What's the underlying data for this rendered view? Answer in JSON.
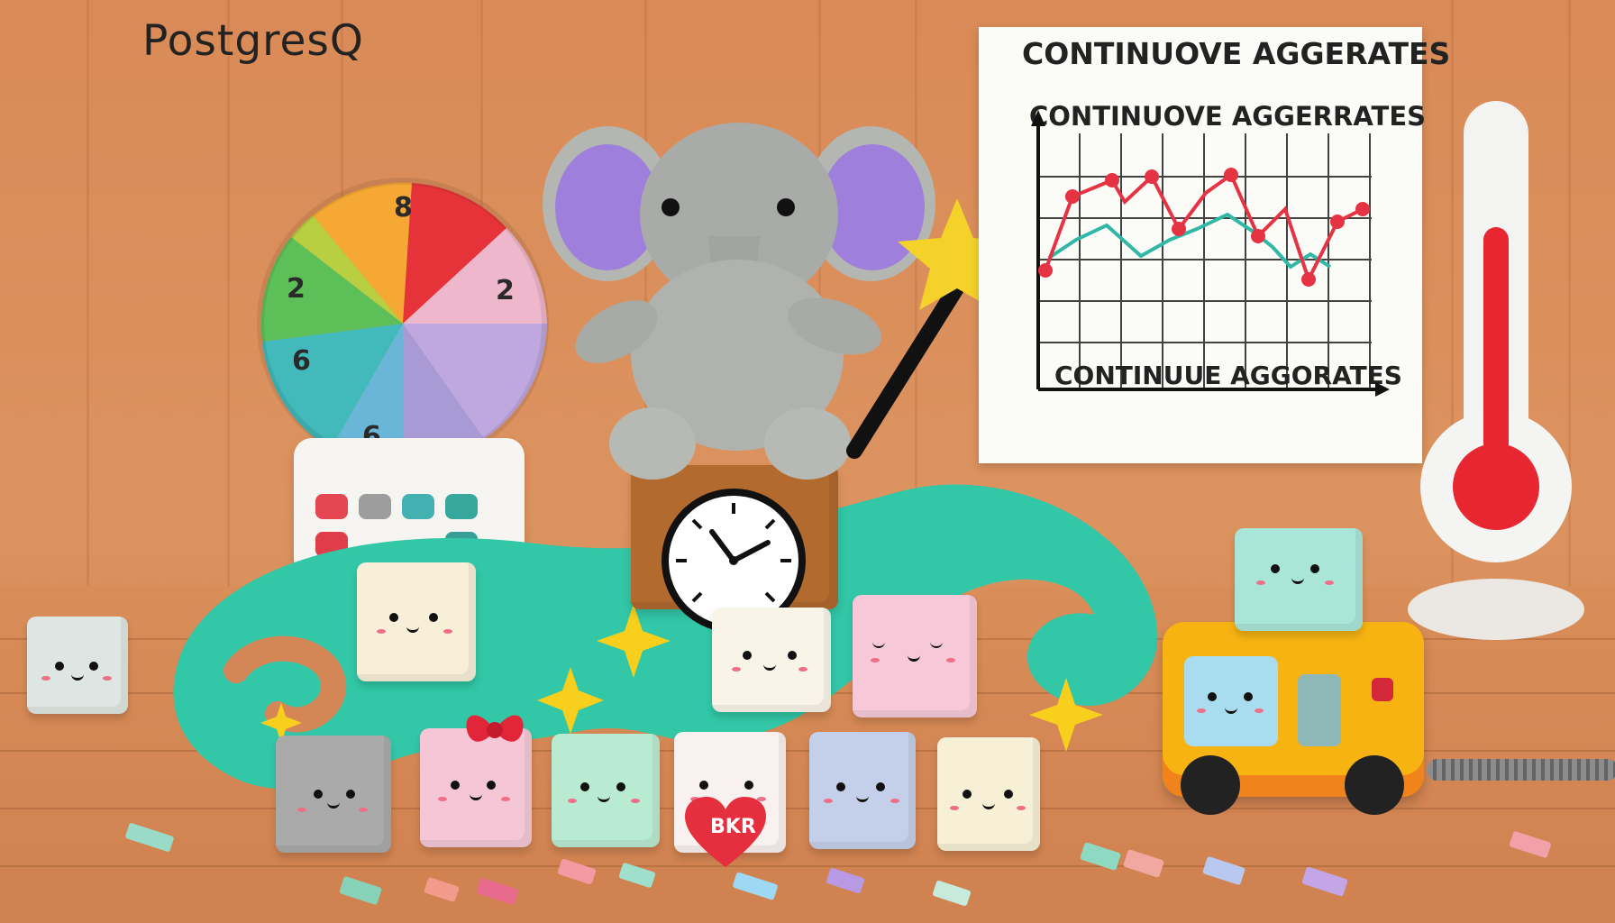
{
  "brand": {
    "text": "PostgresQ"
  },
  "chart_sign": {
    "title": "CONTINUOVE AGGERATES",
    "subtitle": "CONTINUOVE AGGERRATES",
    "bottom": "CONTINUUE AGGORATES"
  },
  "pie_numbers": [
    "8",
    "2",
    "6",
    "6",
    "2"
  ],
  "heart_text": "BKR",
  "colors": {
    "background": "#dc935f",
    "elephant": "#a9aba8",
    "elephant_ear": "#9e80dc",
    "wave": "#31c7a7",
    "clock": "#b26a2e",
    "thermometer_red": "#e82632",
    "chart_red": "#e53343",
    "chart_teal": "#2fb8a5",
    "toy_bus": "#f6b312"
  }
}
